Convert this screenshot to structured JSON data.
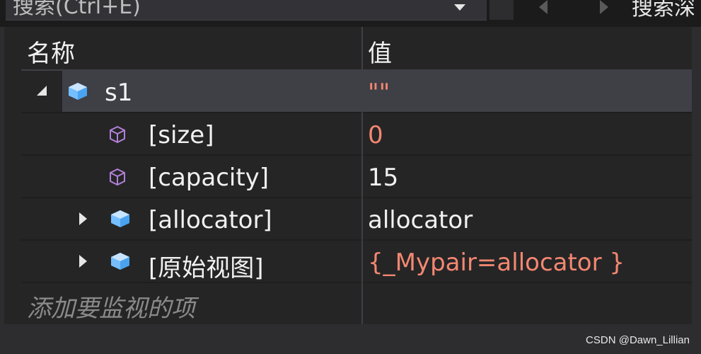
{
  "toolbar": {
    "search_text": "搜索(Ctrl+E)",
    "search_depth_label": "搜索深"
  },
  "columns": {
    "name": "名称",
    "value": "值"
  },
  "rows": [
    {
      "name": "s1",
      "value": "\"\"",
      "icon": "object-icon",
      "expand": "expanded",
      "value_color": "#f48771"
    },
    {
      "name": "[size]",
      "value": "0",
      "icon": "property-icon",
      "expand": "none",
      "value_color": "#f48771"
    },
    {
      "name": "[capacity]",
      "value": "15",
      "icon": "property-icon",
      "expand": "none",
      "value_color": "#f1f1f1"
    },
    {
      "name": "[allocator]",
      "value": "allocator",
      "icon": "object-icon",
      "expand": "collapsed",
      "value_color": "#f1f1f1"
    },
    {
      "name": "[原始视图]",
      "value": "{_Mypair=allocator }",
      "icon": "object-icon",
      "expand": "collapsed",
      "value_color": "#f48771"
    }
  ],
  "add_watch_placeholder": "添加要监视的项",
  "watermark": "CSDN @Dawn_Lillian",
  "colors": {
    "background": "#252526",
    "selected_row": "#3f3f46",
    "changed_value": "#f48771",
    "object_icon": "#75beff",
    "property_icon": "#b180d7"
  }
}
